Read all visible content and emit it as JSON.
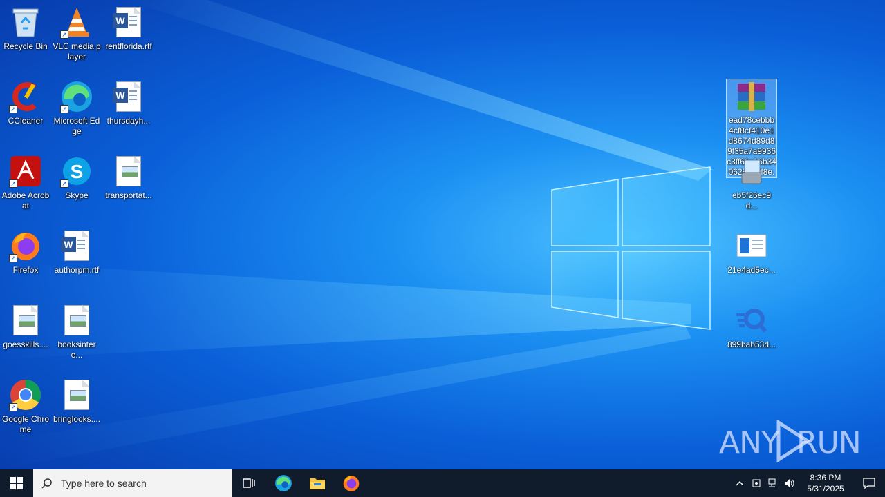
{
  "desktop": {
    "icons_left": [
      {
        "label": "Recycle Bin",
        "icon": "recycle-bin-icon"
      },
      {
        "label": "VLC media player",
        "icon": "vlc-icon"
      },
      {
        "label": "rentflorida.rtf",
        "icon": "word-document-icon"
      },
      {
        "label": "CCleaner",
        "icon": "ccleaner-icon"
      },
      {
        "label": "Microsoft Edge",
        "icon": "edge-icon"
      },
      {
        "label": "thursdayh...",
        "icon": "word-document-icon"
      },
      {
        "label": "Adobe Acrobat",
        "icon": "acrobat-icon"
      },
      {
        "label": "Skype",
        "icon": "skype-icon"
      },
      {
        "label": "transportat...",
        "icon": "image-file-icon"
      },
      {
        "label": "Firefox",
        "icon": "firefox-icon"
      },
      {
        "label": "authorpm.rtf",
        "icon": "word-document-icon"
      },
      {
        "label": "goesskills....",
        "icon": "image-file-icon"
      },
      {
        "label": "booksintere...",
        "icon": "image-file-icon"
      },
      {
        "label": "Google Chrome",
        "icon": "chrome-icon"
      },
      {
        "label": "bringlooks....",
        "icon": "image-file-icon"
      }
    ],
    "icons_right": [
      {
        "label": "ead78cebbb4cf8cf410e1d8674d89d89f35a7a9936c3ff61c16b3406252e0f8e.zip",
        "icon": "winrar-archive-icon",
        "selected": true
      },
      {
        "label": "eb5f26ec9d...",
        "icon": "installer-icon"
      },
      {
        "label": "21e4ad5ec...",
        "icon": "window-app-icon"
      },
      {
        "label": "899bab53d...",
        "icon": "q-app-icon"
      }
    ]
  },
  "watermark": {
    "text_left": "ANY",
    "text_right": "RUN"
  },
  "taskbar": {
    "search_placeholder": "Type here to search",
    "apps": [
      "task-view-icon",
      "edge-icon",
      "file-explorer-icon",
      "firefox-icon"
    ],
    "clock_time": "8:36 PM",
    "clock_date": "5/31/2025"
  },
  "colors": {
    "taskbar": "#101c2b",
    "desktop_accent": "#1b8ff2"
  }
}
